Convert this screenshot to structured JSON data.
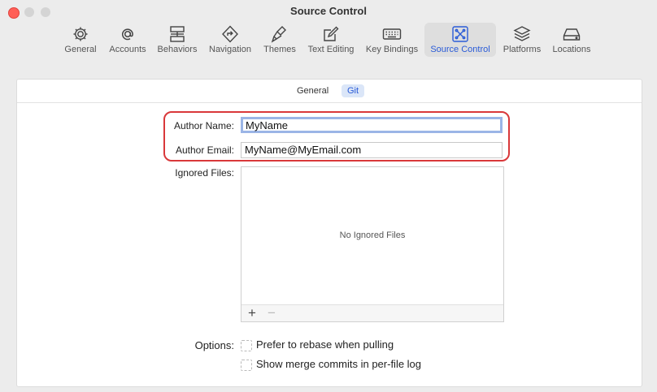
{
  "window": {
    "title": "Source Control"
  },
  "toolbar": {
    "items": [
      {
        "label": "General",
        "icon": "gear-icon"
      },
      {
        "label": "Accounts",
        "icon": "at-icon"
      },
      {
        "label": "Behaviors",
        "icon": "behaviors-icon"
      },
      {
        "label": "Navigation",
        "icon": "navigation-icon"
      },
      {
        "label": "Themes",
        "icon": "brush-icon"
      },
      {
        "label": "Text Editing",
        "icon": "edit-icon"
      },
      {
        "label": "Key Bindings",
        "icon": "keyboard-icon"
      },
      {
        "label": "Source Control",
        "icon": "source-control-icon"
      },
      {
        "label": "Platforms",
        "icon": "stack-icon"
      },
      {
        "label": "Locations",
        "icon": "drive-icon"
      }
    ],
    "active_label": "Source Control"
  },
  "subtabs": {
    "general": "General",
    "git": "Git",
    "active": "Git"
  },
  "form": {
    "author_name_label": "Author Name:",
    "author_name_value": "MyName",
    "author_email_label": "Author Email:",
    "author_email_value": "MyName@MyEmail.com",
    "ignored_files_label": "Ignored Files:",
    "ignored_files_empty": "No Ignored Files",
    "add_symbol": "+",
    "remove_symbol": "−",
    "options_label": "Options:",
    "option_rebase": "Prefer to rebase when pulling",
    "option_merge_commits": "Show merge commits in per-file log"
  },
  "colors": {
    "accent": "#2a5bd7",
    "highlight": "#d9383a",
    "close": "#ff5f57"
  }
}
